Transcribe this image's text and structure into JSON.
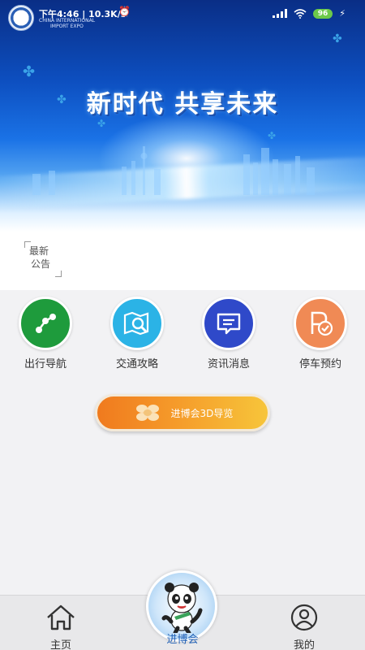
{
  "status_bar": {
    "time": "下午4:46 | 10.3K/s",
    "battery": "96",
    "logo_text": [
      "CHINA INTERNATIONAL",
      "IMPORT EXPO"
    ]
  },
  "banner": {
    "slogan": "新时代  共享未来"
  },
  "notice": {
    "label_line1": "最新",
    "label_line2": "公告"
  },
  "quick_links": [
    {
      "label": "出行导航",
      "icon": "route-icon",
      "color": "#1e9b3c"
    },
    {
      "label": "交通攻略",
      "icon": "map-search-icon",
      "color": "#2bb3e6"
    },
    {
      "label": "资讯消息",
      "icon": "message-icon",
      "color": "#2f49c9"
    },
    {
      "label": "停车预约",
      "icon": "parking-check-icon",
      "color": "#f08a55"
    }
  ],
  "guide_button": {
    "label": "进博会3D导览",
    "icon": "venue-icon"
  },
  "tabbar": {
    "home": "主页",
    "expo": "进博会",
    "mine": "我的"
  },
  "colors": {
    "accent": "#1f5fb5",
    "battery": "#6cc94a"
  }
}
